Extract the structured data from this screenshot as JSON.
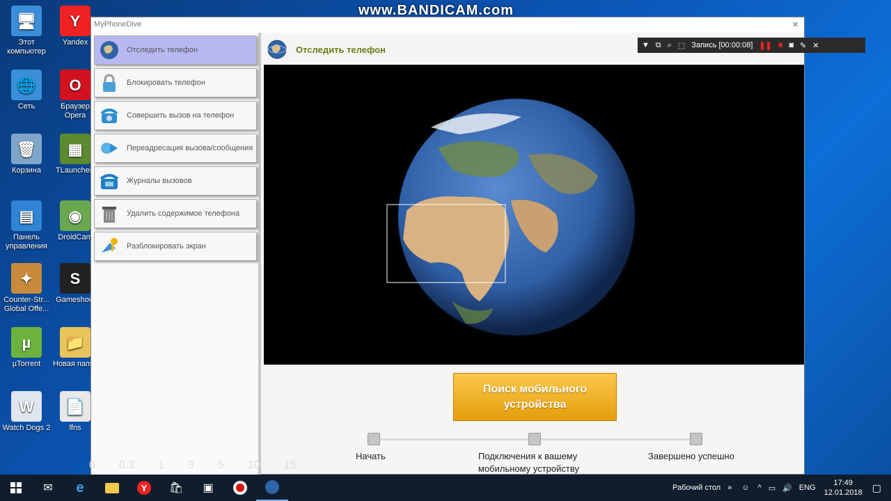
{
  "watermark": "www.BANDICAM.com",
  "desktop_icons": [
    {
      "label": "Этот компьютер",
      "glyph": "🖥",
      "bg": "#3a8fd8"
    },
    {
      "label": "Yandex",
      "glyph": "Y",
      "bg": "#e22"
    },
    {
      "label": "Сеть",
      "glyph": "🌐",
      "bg": "#3a8fd8"
    },
    {
      "label": "Браузер Opera",
      "glyph": "O",
      "bg": "#d3121f"
    },
    {
      "label": "Корзина",
      "glyph": "🗑",
      "bg": "#7fa6c9"
    },
    {
      "label": "TLauncher-",
      "glyph": "▦",
      "bg": "#5c8a2e"
    },
    {
      "label": "Панель управления",
      "glyph": "▤",
      "bg": "#2f84d4"
    },
    {
      "label": "DroidCam",
      "glyph": "◉",
      "bg": "#6aa84f"
    },
    {
      "label": "Counter-Str... Global Offe...",
      "glyph": "✦",
      "bg": "#c98a3a"
    },
    {
      "label": "Gameshow",
      "glyph": "S",
      "bg": "#222"
    },
    {
      "label": "µTorrent",
      "glyph": "µ",
      "bg": "#6cb33e"
    },
    {
      "label": "Новая папка",
      "glyph": "📁",
      "bg": "#e8c45a"
    },
    {
      "label": "Watch Dogs 2",
      "glyph": "W",
      "bg": "#dfe6ef"
    },
    {
      "label": "lfns",
      "glyph": "📄",
      "bg": "#e8e8e8"
    }
  ],
  "app": {
    "title": "MyPhoneDive",
    "close_icon": "×",
    "sidebar": [
      {
        "label": "Отследить телефон",
        "icon": "globe-icon",
        "active": true
      },
      {
        "label": "Блокировать телефон",
        "icon": "lock-icon",
        "active": false
      },
      {
        "label": "Совершить вызов на телефон",
        "icon": "phone-icon",
        "active": false
      },
      {
        "label": "Переадресация вызова/сообщения",
        "icon": "forward-icon",
        "active": false
      },
      {
        "label": "Журналы вызовов",
        "icon": "call-log-icon",
        "active": false
      },
      {
        "label": "Удалить содержимое телефона",
        "icon": "trash-icon",
        "active": false
      },
      {
        "label": "Разблокировать экран",
        "icon": "unlock-icon",
        "active": false
      }
    ],
    "header_title": "Отследить телефон",
    "search_button": "Поиск мобильного устройства",
    "steps": [
      {
        "label": "Начать"
      },
      {
        "label": "Подключения к вашему мобильному устройству"
      },
      {
        "label": "Завершено успешно"
      }
    ]
  },
  "recorder": {
    "record_label": "Запись [00:00:08]"
  },
  "overlay_numbers": [
    "0",
    "0.3",
    "1",
    "3",
    "5",
    "10",
    "15"
  ],
  "taskbar": {
    "desktop_label": "Рабочий стол",
    "lang": "ENG",
    "time": "17:49",
    "date": "12.01.2018"
  }
}
